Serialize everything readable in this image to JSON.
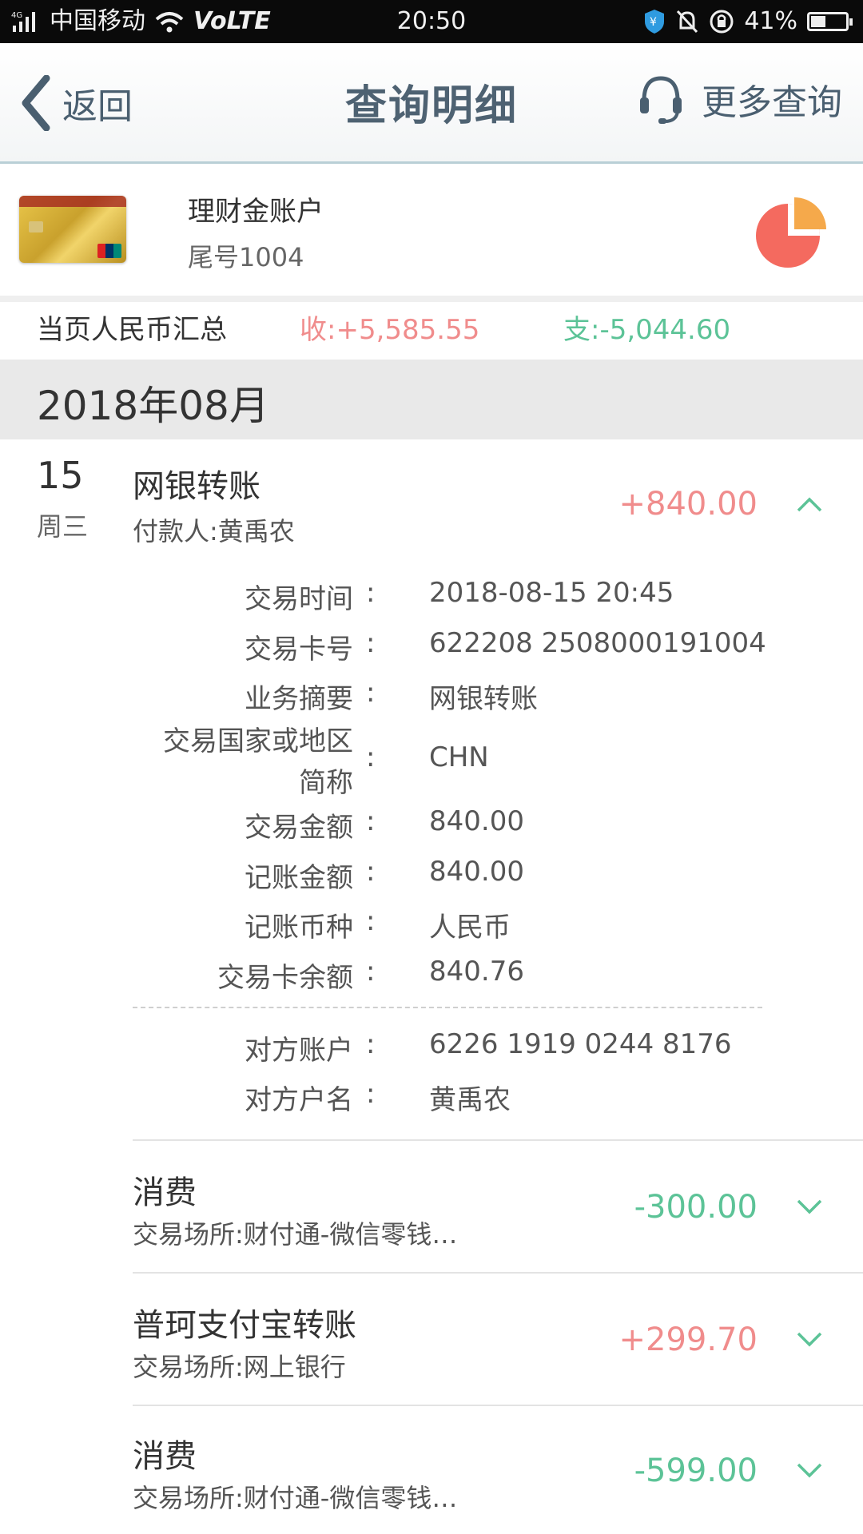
{
  "status_bar": {
    "network": "4G",
    "carrier": "中国移动",
    "volte": "VoLTE",
    "time": "20:50",
    "battery": "41%",
    "battery_level": 0.41
  },
  "nav": {
    "back_label": "返回",
    "title": "查询明细",
    "more_label": "更多查询"
  },
  "account": {
    "name": "理财金账户",
    "tail": "尾号1004"
  },
  "summary": {
    "label": "当页人民币汇总",
    "income": "收:+5,585.55",
    "expense": "支:-5,044.60"
  },
  "month": "2018年08月",
  "first_tx": {
    "day": "15",
    "weekday": "周三",
    "title": "网银转账",
    "sub": "付款人:黄禹农",
    "amount": "+840.00",
    "details": [
      {
        "label": "交易时间",
        "value": "2018-08-15 20:45"
      },
      {
        "label": "交易卡号",
        "value": "622208 2508000191004"
      },
      {
        "label": "业务摘要",
        "value": "网银转账"
      },
      {
        "label_line1": "交易国家或地区",
        "label_line2": "简称",
        "value": "CHN"
      },
      {
        "label": "交易金额",
        "value": "840.00"
      },
      {
        "label": "记账金额",
        "value": "840.00"
      },
      {
        "label": "记账币种",
        "value": "人民币"
      },
      {
        "label": "交易卡余额",
        "value": "840.76"
      }
    ],
    "counterparty": [
      {
        "label": "对方账户",
        "value": "6226 1919 0244 8176"
      },
      {
        "label": "对方户名",
        "value": "黄禹农"
      }
    ],
    "colon": ":"
  },
  "transactions": [
    {
      "title": "消费",
      "sub": "交易场所:财付通-微信零钱…",
      "amount": "-300.00"
    },
    {
      "title": "普珂支付宝转账",
      "sub": "交易场所:网上银行",
      "amount": "+299.70"
    },
    {
      "title": "消费",
      "sub": "交易场所:财付通-微信零钱…",
      "amount": "-599.00"
    }
  ],
  "colors": {
    "income": "#f08c8c",
    "expense": "#5cc397",
    "nav_text": "#4a5f70"
  }
}
